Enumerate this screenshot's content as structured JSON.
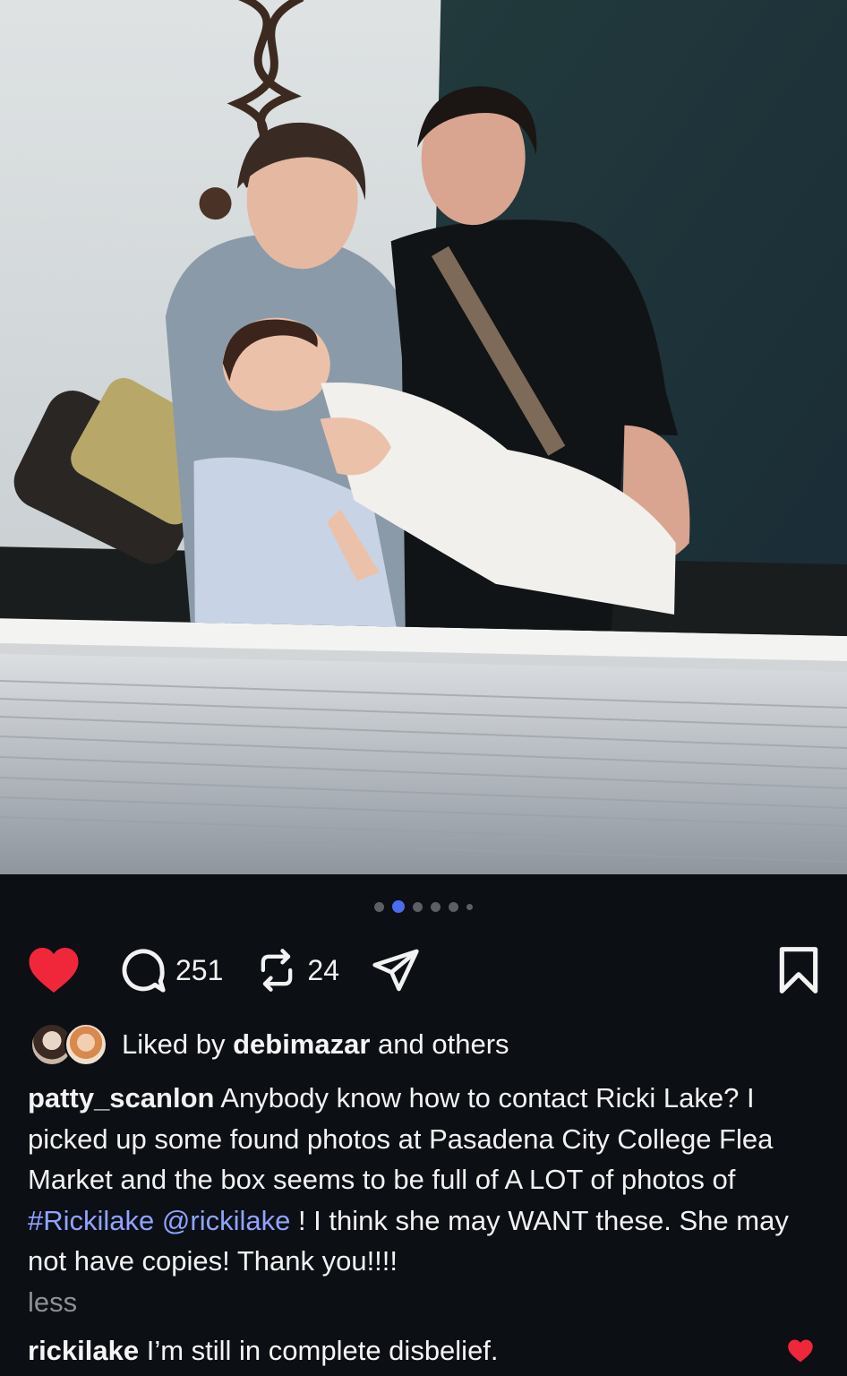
{
  "post": {
    "image_alt": "Scanned snapshot of a woman, a man and a child on a bench, lying on a stack of photos",
    "carousel": {
      "total": 6,
      "active_index": 1
    }
  },
  "actions": {
    "comments_count": "251",
    "reposts_count": "24",
    "liked": true,
    "icons": [
      "heart-icon",
      "comment-icon",
      "repost-icon",
      "share-icon",
      "bookmark-icon"
    ],
    "like_color": "#f0263b"
  },
  "likes": {
    "prefix": "Liked by ",
    "user": "debimazar",
    "suffix": " and others"
  },
  "caption": {
    "username": "patty_scanlon",
    "text_1": " Anybody know how to contact Ricki Lake? I picked up some found photos at Pasadena City College Flea Market and the box seems to be full of A LOT of photos of ",
    "hashtag": "#Rickilake",
    "mention": "@rickilake",
    "text_2": " ! I think she may WANT these. She may not have copies! Thank you!!!!",
    "less_label": "less"
  },
  "comment": {
    "username": "rickilake",
    "text": " I’m still in complete disbelief."
  }
}
